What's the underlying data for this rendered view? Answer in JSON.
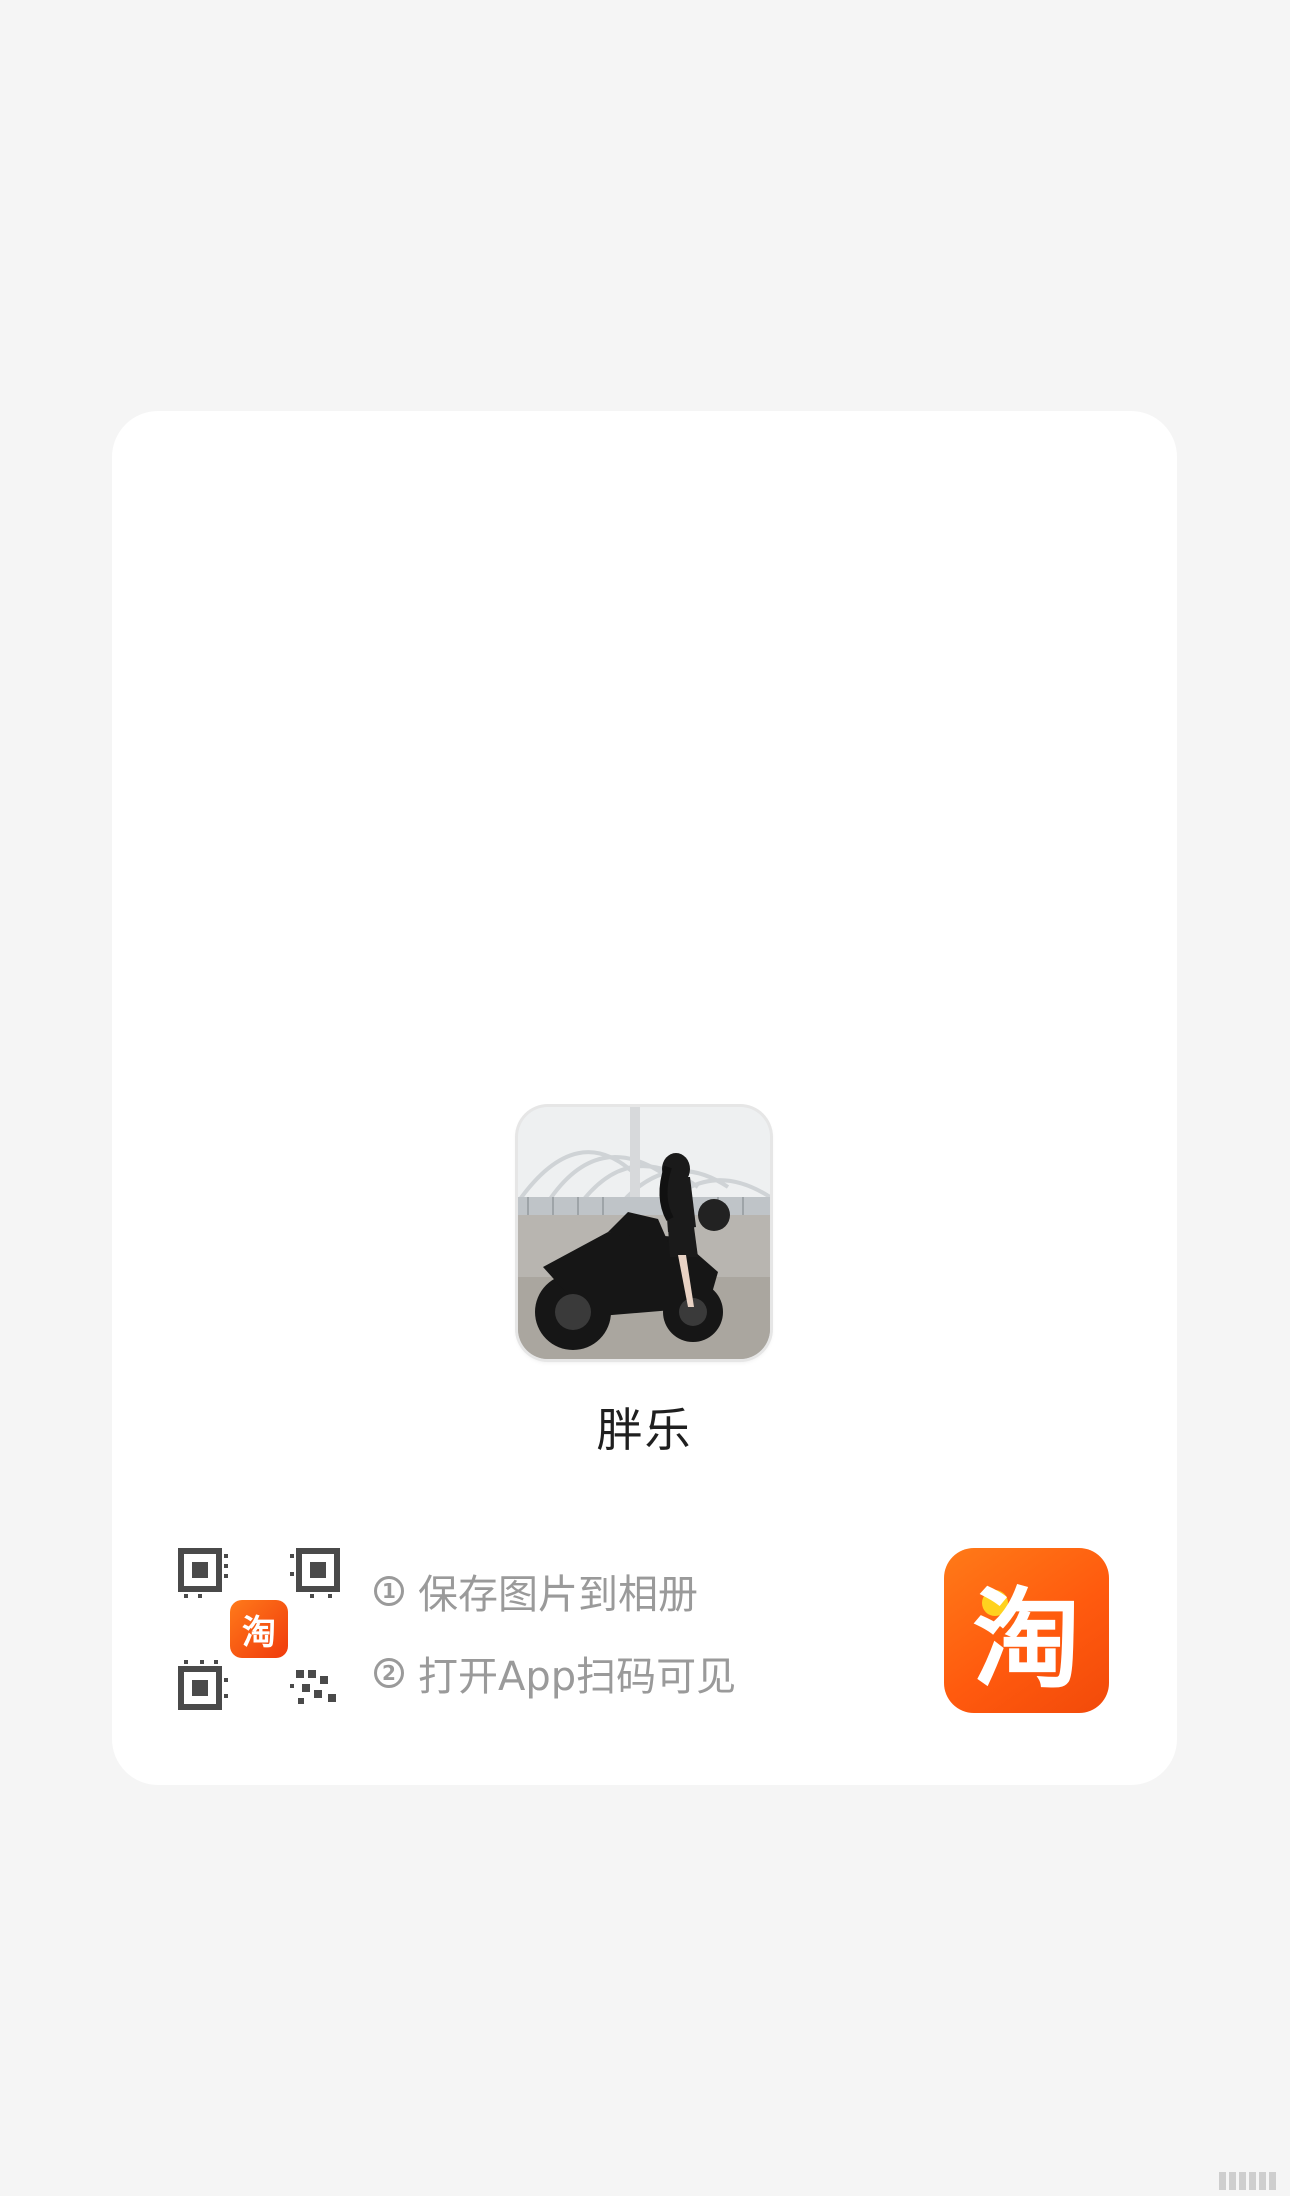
{
  "profile": {
    "nickname": "胖乐",
    "avatar": "avatar-photo-woman-on-motorcycle"
  },
  "qr_code": {
    "logo_char": "淘",
    "icon": "qr-code-icon"
  },
  "steps": [
    {
      "number": "1",
      "text": "保存图片到相册"
    },
    {
      "number": "2",
      "text": "打开App扫码可见"
    }
  ],
  "app": {
    "logo_char": "淘",
    "icon": "taobao-logo-icon",
    "brand_color": "#ff5a0e",
    "accent_dot_color": "#ffd21f"
  },
  "colors": {
    "background": "#f5f5f5",
    "card": "#ffffff",
    "muted_text": "#9a9a9a",
    "primary_text": "#1f1f1f"
  }
}
